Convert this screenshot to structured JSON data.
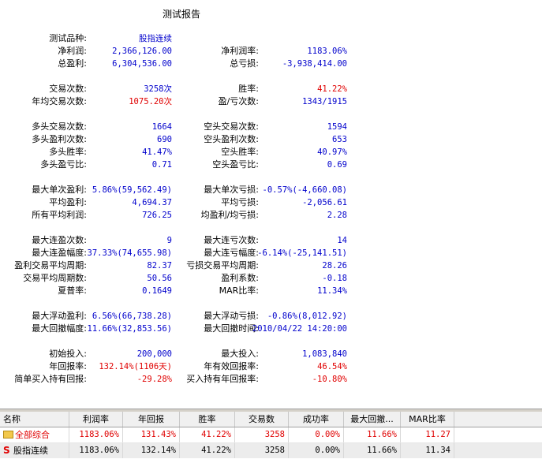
{
  "report": {
    "title": "测试报告",
    "sections": [
      [
        {
          "l1": "测试品种:",
          "v1": "股指连续",
          "c1": "blue",
          "l2": "",
          "v2": "",
          "c2": "blue"
        },
        {
          "l1": "净利润:",
          "v1": "2,366,126.00",
          "c1": "blue",
          "l2": "净利润率:",
          "v2": "1183.06%",
          "c2": "blue"
        },
        {
          "l1": "总盈利:",
          "v1": "6,304,536.00",
          "c1": "blue",
          "l2": "总亏损:",
          "v2": "-3,938,414.00",
          "c2": "blue"
        }
      ],
      [
        {
          "l1": "交易次数:",
          "v1": "3258次",
          "c1": "blue",
          "l2": "胜率:",
          "v2": "41.22%",
          "c2": "red"
        },
        {
          "l1": "年均交易次数:",
          "v1": "1075.20次",
          "c1": "red",
          "l2": "盈/亏次数:",
          "v2": "1343/1915",
          "c2": "blue"
        }
      ],
      [
        {
          "l1": "多头交易次数:",
          "v1": "1664",
          "c1": "blue",
          "l2": "空头交易次数:",
          "v2": "1594",
          "c2": "blue"
        },
        {
          "l1": "多头盈利次数:",
          "v1": "690",
          "c1": "blue",
          "l2": "空头盈利次数:",
          "v2": "653",
          "c2": "blue"
        },
        {
          "l1": "多头胜率:",
          "v1": "41.47%",
          "c1": "blue",
          "l2": "空头胜率:",
          "v2": "40.97%",
          "c2": "blue"
        },
        {
          "l1": "多头盈亏比:",
          "v1": "0.71",
          "c1": "blue",
          "l2": "空头盈亏比:",
          "v2": "0.69",
          "c2": "blue"
        }
      ],
      [
        {
          "l1": "最大单次盈利:",
          "v1": "5.86%(59,562.49)",
          "c1": "blue",
          "l2": "最大单次亏损:",
          "v2": "-0.57%(-4,660.08)",
          "c2": "blue"
        },
        {
          "l1": "平均盈利:",
          "v1": "4,694.37",
          "c1": "blue",
          "l2": "平均亏损:",
          "v2": "-2,056.61",
          "c2": "blue"
        },
        {
          "l1": "所有平均利润:",
          "v1": "726.25",
          "c1": "blue",
          "l2": "均盈利/均亏损:",
          "v2": "2.28",
          "c2": "blue"
        }
      ],
      [
        {
          "l1": "最大连盈次数:",
          "v1": "9",
          "c1": "blue",
          "l2": "最大连亏次数:",
          "v2": "14",
          "c2": "blue"
        },
        {
          "l1": "最大连盈幅度:",
          "v1": "37.33%(74,655.98)",
          "c1": "blue",
          "l2": "最大连亏幅度:",
          "v2": "-6.14%(-25,141.51)",
          "c2": "blue"
        },
        {
          "l1": "盈利交易平均周期:",
          "v1": "82.37",
          "c1": "blue",
          "l2": "亏损交易平均周期:",
          "v2": "28.26",
          "c2": "blue"
        },
        {
          "l1": "交易平均周期数:",
          "v1": "50.56",
          "c1": "blue",
          "l2": "盈利系数:",
          "v2": "-0.18",
          "c2": "blue"
        },
        {
          "l1": "夏普率:",
          "v1": "0.1649",
          "c1": "blue",
          "l2": "MAR比率:",
          "v2": "11.34%",
          "c2": "blue"
        }
      ],
      [
        {
          "l1": "最大浮动盈利:",
          "v1": "6.56%(66,738.28)",
          "c1": "blue",
          "l2": "最大浮动亏损:",
          "v2": "-0.86%(8,012.92)",
          "c2": "blue"
        },
        {
          "l1": "最大回撤幅度:",
          "v1": "11.66%(32,853.56)",
          "c1": "blue",
          "l2": "最大回撤时间:",
          "v2": "2010/04/22 14:20:00",
          "c2": "blue"
        }
      ],
      [
        {
          "l1": "初始投入:",
          "v1": "200,000",
          "c1": "blue",
          "l2": "最大投入:",
          "v2": "1,083,840",
          "c2": "blue"
        },
        {
          "l1": "年回报率:",
          "v1": "132.14%(1106天)",
          "c1": "red",
          "l2": "年有效回报率:",
          "v2": "46.54%",
          "c2": "red"
        },
        {
          "l1": "简单买入持有回报:",
          "v1": "-29.28%",
          "c1": "red",
          "l2": "买入持有年回报率:",
          "v2": "-10.80%",
          "c2": "red"
        }
      ]
    ]
  },
  "grid": {
    "headers": [
      "名称",
      "利润率",
      "年回报",
      "胜率",
      "交易数",
      "成功率",
      "最大回撤...",
      "MAR比率"
    ],
    "rows": [
      {
        "icon": "folder-icon",
        "name": "全部综合",
        "values": [
          "1183.06%",
          "131.43%",
          "41.22%",
          "3258",
          "0.00%",
          "11.66%",
          "11.27"
        ]
      },
      {
        "icon": "s-icon",
        "name": "股指连续",
        "values": [
          "1183.06%",
          "132.14%",
          "41.22%",
          "3258",
          "0.00%",
          "11.66%",
          "11.34"
        ]
      }
    ]
  },
  "colors": {
    "blue": "#0000cc",
    "red": "#e00000"
  }
}
